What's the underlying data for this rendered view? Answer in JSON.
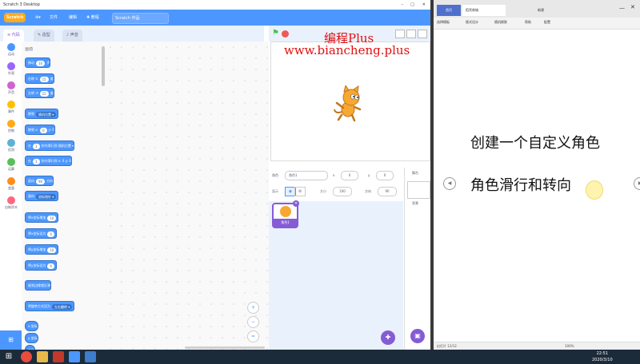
{
  "scratch": {
    "window_title": "Scratch 3 Desktop",
    "menu": {
      "logo": "Scratch",
      "file": "文件",
      "edit": "编辑",
      "tutorials": "教程",
      "project_name": "Scratch 作品"
    },
    "tabs": [
      "代码",
      "造型",
      "声音"
    ],
    "categories": [
      {
        "label": "运动",
        "color": "#4c97ff"
      },
      {
        "label": "外观",
        "color": "#9966ff"
      },
      {
        "label": "声音",
        "color": "#cf63cf"
      },
      {
        "label": "事件",
        "color": "#ffbf00"
      },
      {
        "label": "控制",
        "color": "#ffab19"
      },
      {
        "label": "侦测",
        "color": "#5cb1d6"
      },
      {
        "label": "运算",
        "color": "#59c059"
      },
      {
        "label": "变量",
        "color": "#ff8c1a"
      },
      {
        "label": "自制积木",
        "color": "#ff6680"
      }
    ],
    "palette_header": "运动",
    "blocks": [
      {
        "pre": "移动",
        "pill": "10",
        "post": "步"
      },
      {
        "pre": "右转 ↻",
        "pill": "15",
        "post": "度"
      },
      {
        "pre": "左转 ↺",
        "pill": "15",
        "post": "度"
      },
      {
        "pre": "移到",
        "pill": "随机位置 ▾",
        "post": ""
      },
      {
        "pre": "移到 x:",
        "pill": "0",
        "post": "y: 0"
      },
      {
        "pre": "在",
        "pill": "1",
        "post": "秒内滑行到 随机位置 ▾"
      },
      {
        "pre": "在",
        "pill": "1",
        "post": "秒内滑行到 x: 0 y: 0"
      },
      {
        "pre": "面向",
        "pill": "90",
        "post": "方向"
      },
      {
        "pre": "面向",
        "pill": "鼠标指针 ▾",
        "post": ""
      },
      {
        "pre": "将x坐标增加",
        "pill": "10",
        "post": ""
      },
      {
        "pre": "将x坐标设为",
        "pill": "0",
        "post": ""
      },
      {
        "pre": "将y坐标增加",
        "pill": "10",
        "post": ""
      },
      {
        "pre": "将y坐标设为",
        "pill": "0",
        "post": ""
      },
      {
        "pre": "碰到边缘就反弹",
        "pill": "",
        "post": ""
      },
      {
        "pre": "将旋转方式设为",
        "pill": "左右翻转 ▾",
        "post": ""
      },
      {
        "pre": "",
        "pill": "x 坐标",
        "post": ""
      },
      {
        "pre": "",
        "pill": "y 坐标",
        "post": ""
      },
      {
        "pre": "",
        "pill": "方向",
        "post": ""
      }
    ],
    "stage_overlay": {
      "line1": "编程Plus",
      "line2": "www.biancheng.plus"
    },
    "sprite_info": {
      "sprite_label": "角色",
      "sprite_name": "角色1",
      "x_label": "x",
      "x_val": "0",
      "y_label": "y",
      "y_val": "0",
      "show_label": "显示",
      "size_label": "大小",
      "size_val": "100",
      "direction_label": "方向",
      "direction_val": "90"
    },
    "sprite_thumb_label": "角色1",
    "backdrop_label": "舞台",
    "backdrop_sub": "背景"
  },
  "wps": {
    "tabs": [
      "首页",
      "稻壳商城",
      "新建"
    ],
    "toolbar": [
      "选择模板",
      "版式设计",
      "随机换肤",
      "帮助",
      "配置"
    ],
    "slide_line1": "创建一个自定义角色",
    "slide_line2": "角色滑行和转向",
    "status_left": "幻灯片 12/12",
    "status_zoom": "100%"
  },
  "taskbar": {
    "time": "22:51",
    "date": "2020/3/10"
  }
}
